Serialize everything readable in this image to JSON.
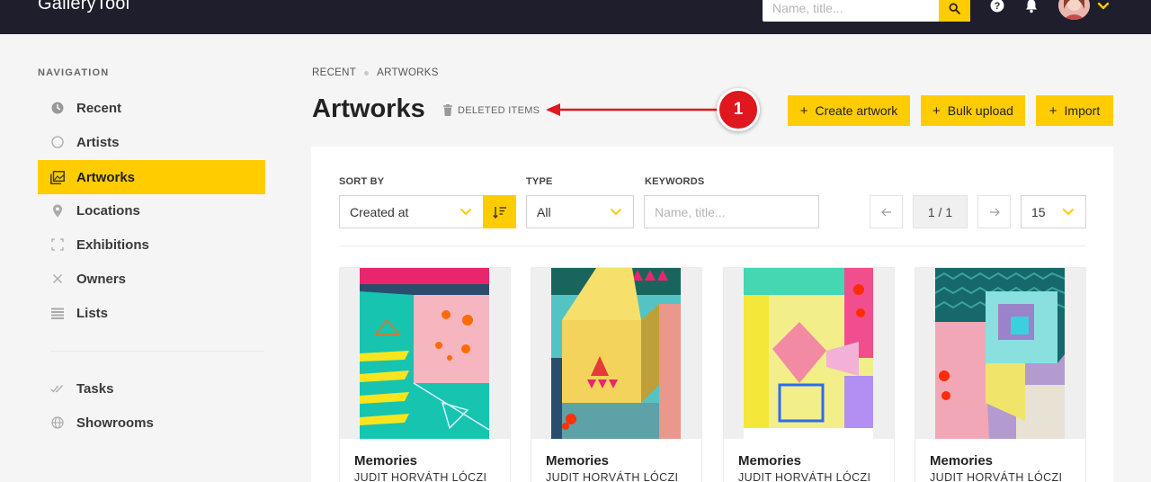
{
  "app": {
    "brand": "GalleryTool"
  },
  "header": {
    "search_placeholder": "Name, title...",
    "icons": [
      "search-icon",
      "help-icon",
      "bell-icon",
      "avatar",
      "chevron-down-icon"
    ]
  },
  "sidebar": {
    "heading": "NAVIGATION",
    "items": [
      {
        "label": "Recent",
        "icon": "clock-icon"
      },
      {
        "label": "Artists",
        "icon": "circle-icon"
      },
      {
        "label": "Artworks",
        "icon": "images-icon",
        "active": true
      },
      {
        "label": "Locations",
        "icon": "pin-icon"
      },
      {
        "label": "Exhibitions",
        "icon": "frame-icon"
      },
      {
        "label": "Owners",
        "icon": "close-icon"
      },
      {
        "label": "Lists",
        "icon": "list-icon"
      }
    ],
    "secondary": [
      {
        "label": "Tasks",
        "icon": "check-icon"
      },
      {
        "label": "Showrooms",
        "icon": "globe-icon"
      }
    ]
  },
  "breadcrumb": [
    "RECENT",
    "ARTWORKS"
  ],
  "page": {
    "title": "Artworks",
    "deleted_items": "DELETED ITEMS",
    "badge": "1"
  },
  "actions": [
    {
      "label": "Create artwork"
    },
    {
      "label": "Bulk upload"
    },
    {
      "label": "Import"
    }
  ],
  "filters": {
    "sort_by": {
      "label": "SORT BY",
      "value": "Created at"
    },
    "type": {
      "label": "TYPE",
      "value": "All"
    },
    "keywords": {
      "label": "KEYWORDS",
      "placeholder": "Name, title..."
    }
  },
  "pagination": {
    "page": "1 / 1",
    "per_page": "15"
  },
  "artworks": [
    {
      "title": "Memories",
      "artist": "JUDIT HORVÁTH LÓCZI"
    },
    {
      "title": "Memories",
      "artist": "JUDIT HORVÁTH LÓCZI"
    },
    {
      "title": "Memories",
      "artist": "JUDIT HORVÁTH LÓCZI"
    },
    {
      "title": "Memories",
      "artist": "JUDIT HORVÁTH LÓCZI"
    }
  ],
  "colors": {
    "accent": "#ffcc00",
    "topbar": "#1e1e2d",
    "badge": "#e0171e"
  }
}
